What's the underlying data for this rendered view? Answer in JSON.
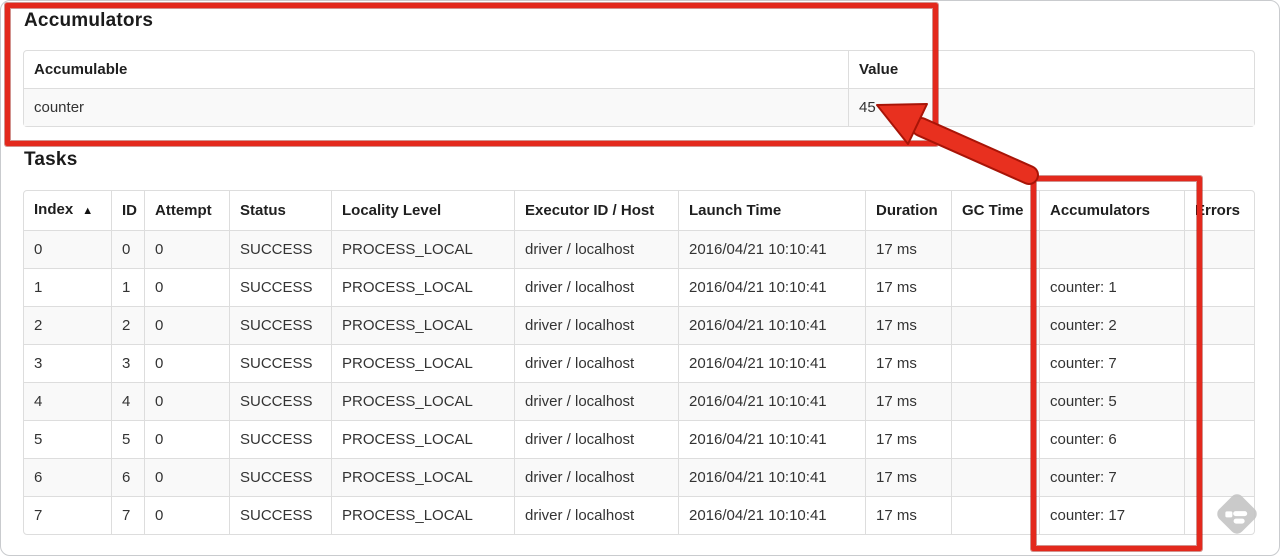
{
  "accumulators_section": {
    "title": "Accumulators",
    "columns": [
      {
        "key": "accumulable",
        "label": "Accumulable"
      },
      {
        "key": "value",
        "label": "Value"
      }
    ],
    "rows": [
      {
        "accumulable": "counter",
        "value": "45"
      }
    ]
  },
  "tasks_section": {
    "title": "Tasks",
    "sort_icon": "▲",
    "columns": [
      {
        "key": "index",
        "label": "Index",
        "sorted": true
      },
      {
        "key": "id",
        "label": "ID"
      },
      {
        "key": "attempt",
        "label": "Attempt"
      },
      {
        "key": "status",
        "label": "Status"
      },
      {
        "key": "locality_level",
        "label": "Locality Level"
      },
      {
        "key": "executor_id_host",
        "label": "Executor ID / Host"
      },
      {
        "key": "launch_time",
        "label": "Launch Time"
      },
      {
        "key": "duration",
        "label": "Duration"
      },
      {
        "key": "gc_time",
        "label": "GC Time"
      },
      {
        "key": "accumulators",
        "label": "Accumulators"
      },
      {
        "key": "errors",
        "label": "Errors"
      }
    ],
    "rows": [
      {
        "index": "0",
        "id": "0",
        "attempt": "0",
        "status": "SUCCESS",
        "locality_level": "PROCESS_LOCAL",
        "executor_id_host": "driver / localhost",
        "launch_time": "2016/04/21 10:10:41",
        "duration": "17 ms",
        "gc_time": "",
        "accumulators": "",
        "errors": ""
      },
      {
        "index": "1",
        "id": "1",
        "attempt": "0",
        "status": "SUCCESS",
        "locality_level": "PROCESS_LOCAL",
        "executor_id_host": "driver / localhost",
        "launch_time": "2016/04/21 10:10:41",
        "duration": "17 ms",
        "gc_time": "",
        "accumulators": "counter: 1",
        "errors": ""
      },
      {
        "index": "2",
        "id": "2",
        "attempt": "0",
        "status": "SUCCESS",
        "locality_level": "PROCESS_LOCAL",
        "executor_id_host": "driver / localhost",
        "launch_time": "2016/04/21 10:10:41",
        "duration": "17 ms",
        "gc_time": "",
        "accumulators": "counter: 2",
        "errors": ""
      },
      {
        "index": "3",
        "id": "3",
        "attempt": "0",
        "status": "SUCCESS",
        "locality_level": "PROCESS_LOCAL",
        "executor_id_host": "driver / localhost",
        "launch_time": "2016/04/21 10:10:41",
        "duration": "17 ms",
        "gc_time": "",
        "accumulators": "counter: 7",
        "errors": ""
      },
      {
        "index": "4",
        "id": "4",
        "attempt": "0",
        "status": "SUCCESS",
        "locality_level": "PROCESS_LOCAL",
        "executor_id_host": "driver / localhost",
        "launch_time": "2016/04/21 10:10:41",
        "duration": "17 ms",
        "gc_time": "",
        "accumulators": "counter: 5",
        "errors": ""
      },
      {
        "index": "5",
        "id": "5",
        "attempt": "0",
        "status": "SUCCESS",
        "locality_level": "PROCESS_LOCAL",
        "executor_id_host": "driver / localhost",
        "launch_time": "2016/04/21 10:10:41",
        "duration": "17 ms",
        "gc_time": "",
        "accumulators": "counter: 6",
        "errors": ""
      },
      {
        "index": "6",
        "id": "6",
        "attempt": "0",
        "status": "SUCCESS",
        "locality_level": "PROCESS_LOCAL",
        "executor_id_host": "driver / localhost",
        "launch_time": "2016/04/21 10:10:41",
        "duration": "17 ms",
        "gc_time": "",
        "accumulators": "counter: 7",
        "errors": ""
      },
      {
        "index": "7",
        "id": "7",
        "attempt": "0",
        "status": "SUCCESS",
        "locality_level": "PROCESS_LOCAL",
        "executor_id_host": "driver / localhost",
        "launch_time": "2016/04/21 10:10:41",
        "duration": "17 ms",
        "gc_time": "",
        "accumulators": "counter: 17",
        "errors": ""
      }
    ]
  },
  "annotations": {
    "color": "#e3291d",
    "box_1_target": "accumulators-section",
    "box_2_target": "tasks-accumulators-column",
    "arrow_points_to": "45"
  }
}
